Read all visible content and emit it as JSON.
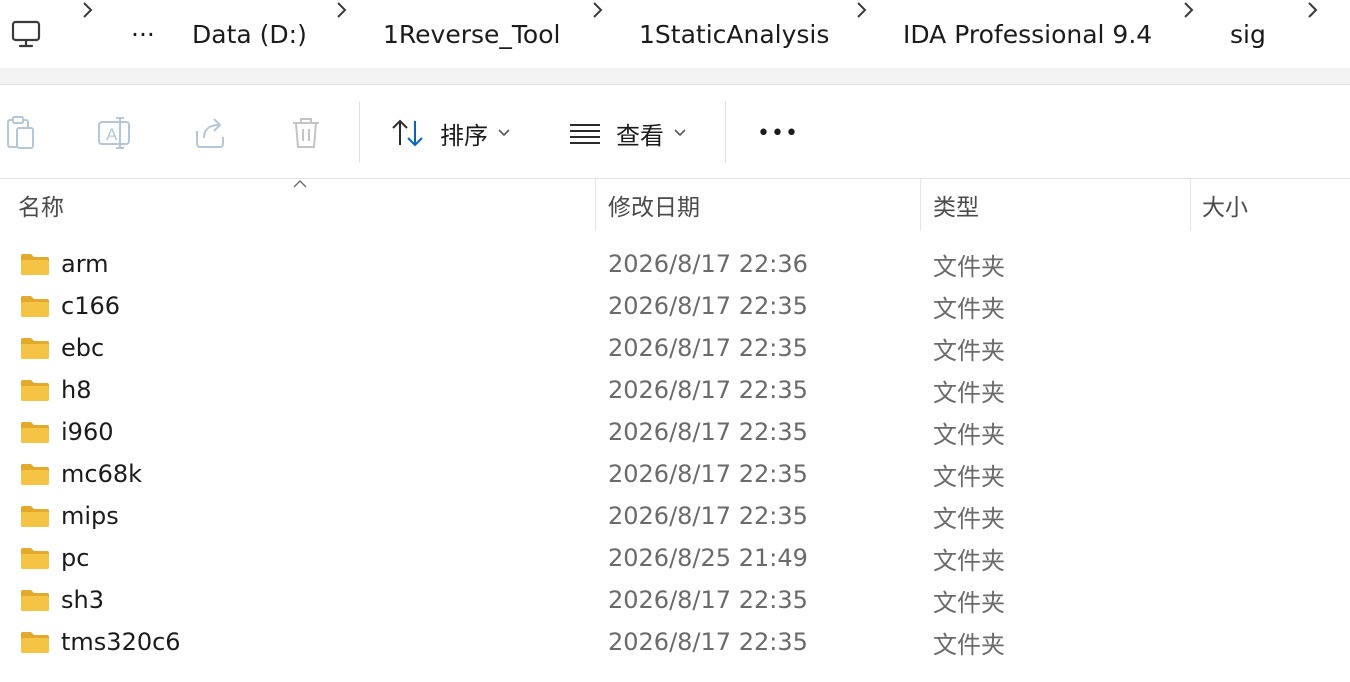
{
  "address_bar": {
    "ellipsis": "···",
    "crumbs": [
      "Data (D:)",
      "1Reverse_Tool",
      "1StaticAnalysis",
      "IDA Professional 9.4",
      "sig"
    ]
  },
  "toolbar": {
    "sort_label": "排序",
    "view_label": "查看",
    "more_label": "•••"
  },
  "columns": {
    "name": "名称",
    "modified": "修改日期",
    "type": "类型",
    "size": "大小"
  },
  "files": [
    {
      "name": "arm",
      "modified": "2026/8/17 22:36",
      "type": "文件夹"
    },
    {
      "name": "c166",
      "modified": "2026/8/17 22:35",
      "type": "文件夹"
    },
    {
      "name": "ebc",
      "modified": "2026/8/17 22:35",
      "type": "文件夹"
    },
    {
      "name": "h8",
      "modified": "2026/8/17 22:35",
      "type": "文件夹"
    },
    {
      "name": "i960",
      "modified": "2026/8/17 22:35",
      "type": "文件夹"
    },
    {
      "name": "mc68k",
      "modified": "2026/8/17 22:35",
      "type": "文件夹"
    },
    {
      "name": "mips",
      "modified": "2026/8/17 22:35",
      "type": "文件夹"
    },
    {
      "name": "pc",
      "modified": "2026/8/25 21:49",
      "type": "文件夹"
    },
    {
      "name": "sh3",
      "modified": "2026/8/17 22:35",
      "type": "文件夹"
    },
    {
      "name": "tms320c6",
      "modified": "2026/8/17 22:35",
      "type": "文件夹"
    }
  ],
  "colors": {
    "folder": "#f5c445",
    "folder_dark": "#e3a92a",
    "accent": "#0067c0"
  }
}
